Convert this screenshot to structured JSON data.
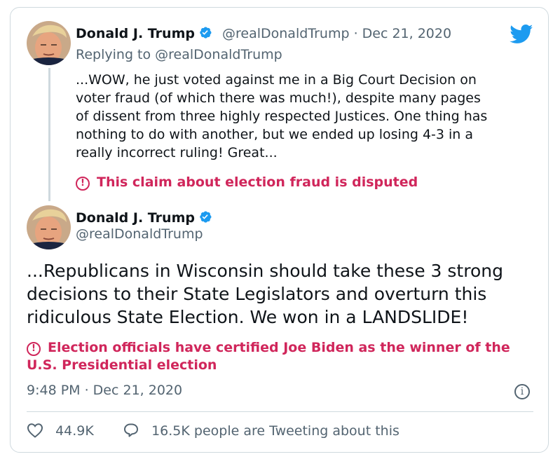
{
  "brand": {
    "logo_icon": "twitter-bird-icon",
    "color": "#1d9bf0"
  },
  "colors": {
    "warning": "#d0265b",
    "muted": "#536471",
    "text": "#0f1419",
    "border": "#cfd9de"
  },
  "quoted_tweet": {
    "author_name": "Donald J. Trump",
    "handle": "@realDonaldTrump",
    "date_text": "· Dec 21, 2020",
    "replying_to": "Replying to @realDonaldTrump",
    "body": "...WOW, he just voted against me in a Big Court Decision on\nvoter fraud (of which there was much!), despite many pages\nof dissent from three highly respected Justices. One thing has\nnothing to do with another, but we ended up losing 4-3 in a\nreally incorrect ruling! Great...",
    "notice": "This claim about election fraud is disputed",
    "notice_icon": "exclamation-circle-icon"
  },
  "main_tweet": {
    "author_name": "Donald J. Trump",
    "handle": "@realDonaldTrump",
    "body": "...Republicans in Wisconsin should take these 3 strong\ndecisions to their State Legislators and overturn this\nridiculous State Election. We won in a LANDSLIDE!",
    "notice": "Election officials have certified Joe Biden as the winner of the U.S. Presidential election",
    "notice_icon": "exclamation-circle-icon",
    "timestamp": "9:48 PM · Dec 21, 2020",
    "info_icon": "info-icon",
    "likes": "44.9K",
    "like_icon": "heart-icon",
    "reply_icon": "speech-bubble-icon",
    "tweeting_text": "16.5K people are Tweeting about this"
  }
}
